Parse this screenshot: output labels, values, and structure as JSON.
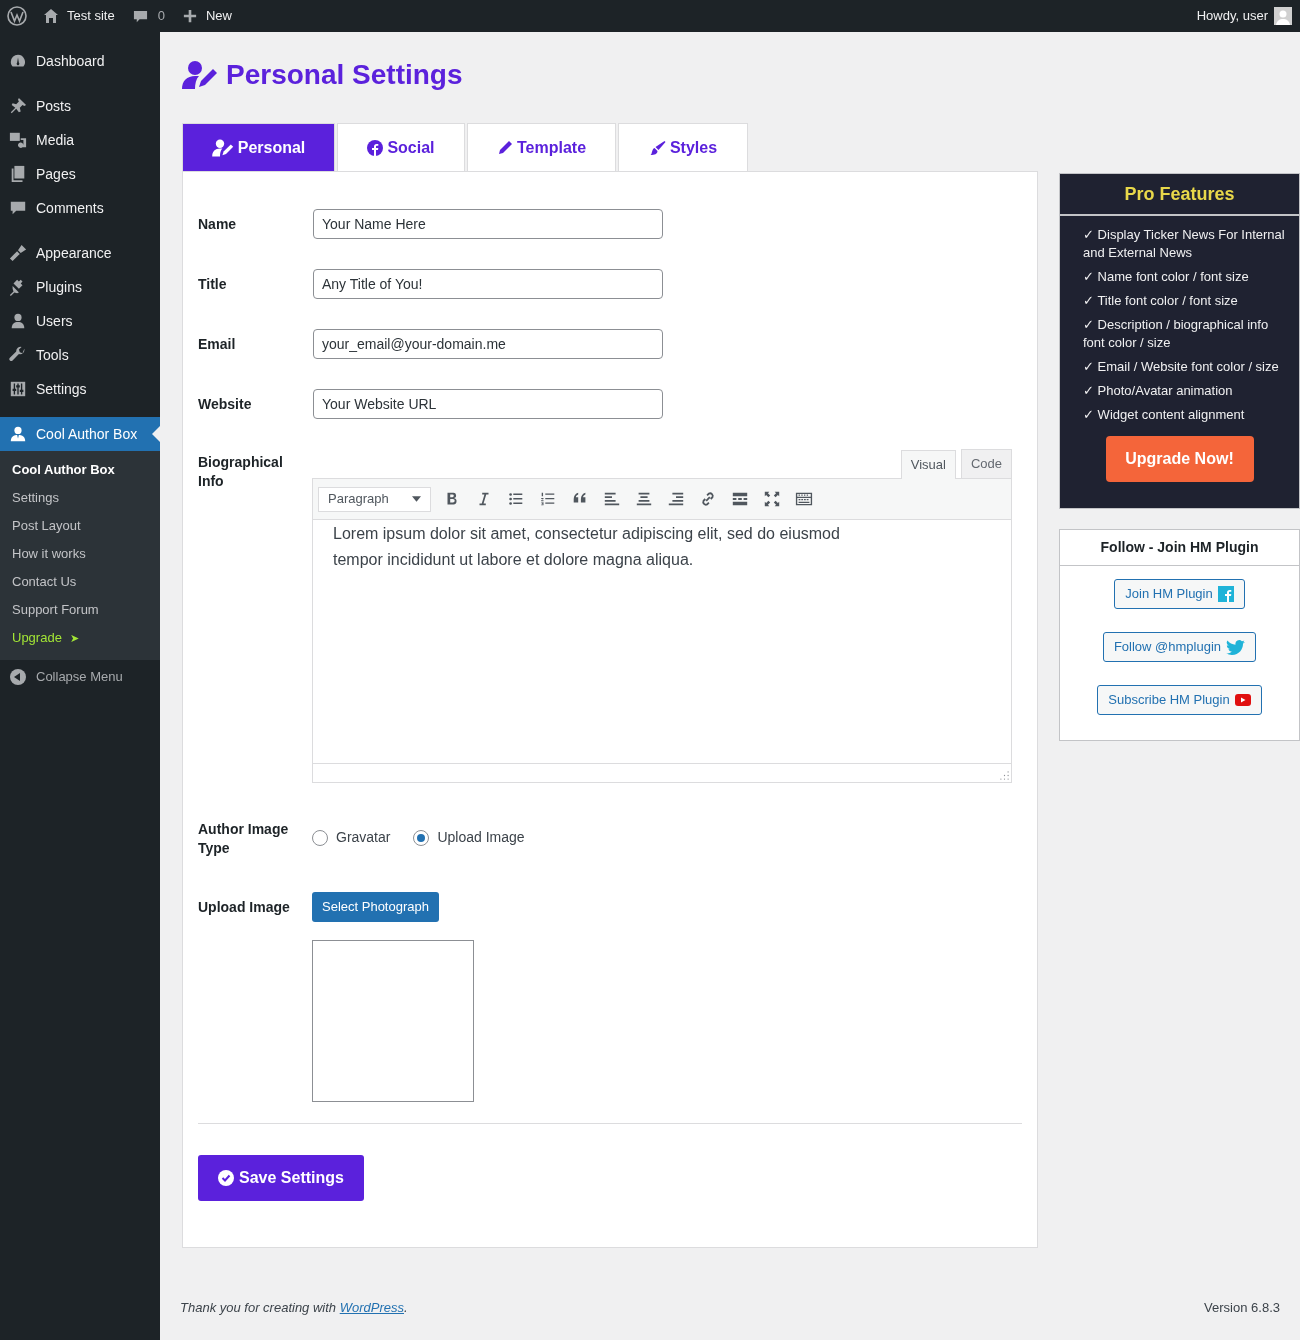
{
  "admin_bar": {
    "site": "Test site",
    "comments": "0",
    "new": "New",
    "greeting": "Howdy, user"
  },
  "menu": {
    "groups": [
      [
        {
          "label": "Dashboard",
          "selected": false
        }
      ],
      [
        {
          "label": "Posts",
          "selected": false
        },
        {
          "label": "Media",
          "selected": false
        },
        {
          "label": "Pages",
          "selected": false
        },
        {
          "label": "Comments",
          "selected": false
        }
      ],
      [
        {
          "label": "Appearance",
          "selected": false
        },
        {
          "label": "Plugins",
          "selected": false
        },
        {
          "label": "Users",
          "selected": false
        },
        {
          "label": "Tools",
          "selected": false
        },
        {
          "label": "Settings",
          "selected": false
        }
      ],
      [
        {
          "label": "Cool Author Box",
          "selected": true
        }
      ]
    ],
    "submenu": [
      {
        "label": "Cool Author Box",
        "kind": "current"
      },
      {
        "label": "Settings",
        "kind": "link"
      },
      {
        "label": "Post Layout",
        "kind": "link"
      },
      {
        "label": "How it works",
        "kind": "link"
      },
      {
        "label": "Contact Us",
        "kind": "link"
      },
      {
        "label": "Support Forum",
        "kind": "link"
      },
      {
        "label": "Upgrade",
        "kind": "upgrade",
        "arrow": "➤"
      }
    ],
    "collapse": "Collapse Menu"
  },
  "page_title": "Personal Settings",
  "tabs": [
    {
      "label": "Personal",
      "selected": true
    },
    {
      "label": "Social",
      "selected": false
    },
    {
      "label": "Template",
      "selected": false
    },
    {
      "label": "Styles",
      "selected": false
    }
  ],
  "fields": [
    {
      "label": "Name",
      "value": "Your Name Here"
    },
    {
      "label": "Title",
      "value": "Any Title of You!"
    },
    {
      "label": "Email",
      "value": "your_email@your-domain.me"
    },
    {
      "label": "Website",
      "value": "Your Website URL"
    }
  ],
  "bio": {
    "label": "Biographical Info",
    "editor_tabs": [
      {
        "label": "Visual",
        "selected": true
      },
      {
        "label": "Code",
        "selected": false
      }
    ],
    "format": "Paragraph",
    "text": "Lorem ipsum dolor sit amet, consectetur adipiscing elit, sed do eiusmod tempor incididunt ut labore et dolore magna aliqua."
  },
  "image_type": {
    "label": "Author Image Type",
    "options": [
      {
        "label": "Gravatar",
        "selected": false
      },
      {
        "label": "Upload Image",
        "selected": true
      }
    ]
  },
  "upload": {
    "label": "Upload Image",
    "button": "Select Photograph"
  },
  "save_button": "Save Settings",
  "pro": {
    "title": "Pro Features",
    "features": [
      "✓ Display Ticker News For Internal and External News",
      "✓ Name font color / font size",
      "✓ Title font color / font size",
      "✓ Description / biographical info font color / size",
      "✓ Email / Website font color / size",
      "✓ Photo/Avatar animation",
      "✓ Widget content alignment"
    ],
    "button": "Upgrade Now!"
  },
  "follow": {
    "title": "Follow - Join HM Plugin",
    "links": [
      {
        "label": "Join HM Plugin",
        "kind": "facebook"
      },
      {
        "label": "Follow @hmplugin",
        "kind": "twitter"
      },
      {
        "label": "Subscribe HM Plugin",
        "kind": "youtube"
      }
    ]
  },
  "footer": {
    "before": "Thank you for creating with ",
    "link": "WordPress",
    "after": ".",
    "version": "Version 6.8.3"
  }
}
